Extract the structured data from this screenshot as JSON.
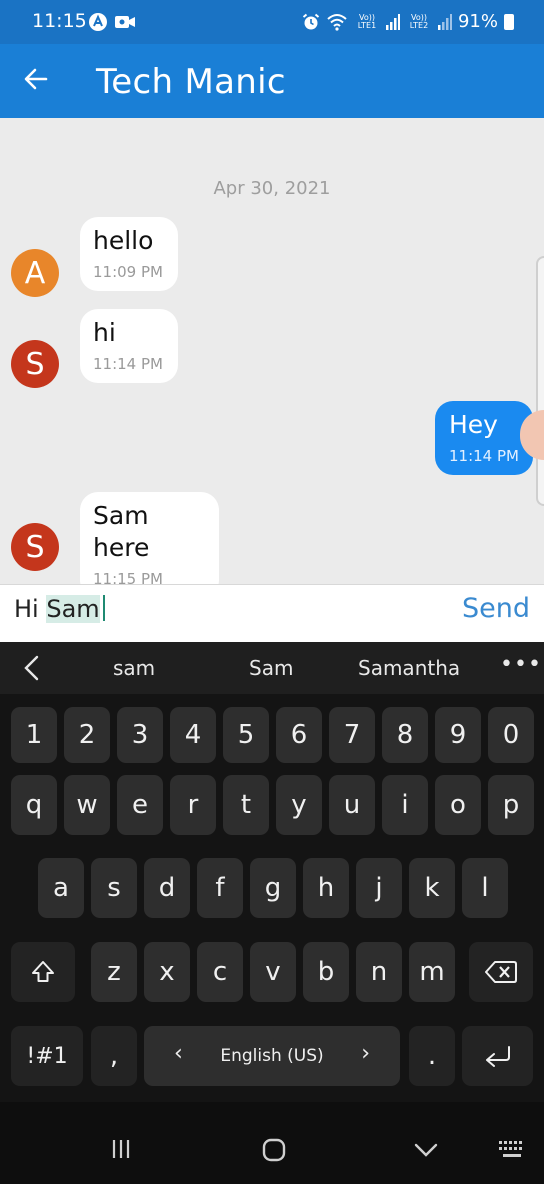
{
  "status_bar": {
    "time": "11:15",
    "battery": "91%",
    "sim1": "Vo)) LTE1",
    "sim2": "Vo)) LTE2",
    "icons": [
      "app-a-icon",
      "video-icon",
      "alarm-icon",
      "wifi-icon",
      "signal-icon",
      "battery-icon"
    ]
  },
  "app_bar": {
    "title": "Tech Manic",
    "back_icon": "back-arrow-icon"
  },
  "chat": {
    "date": "Apr 30, 2021",
    "messages": [
      {
        "avatar": "A",
        "text": "hello",
        "time": "11:09 PM",
        "direction": "in",
        "avatar_color": "#e8862a"
      },
      {
        "avatar": "S",
        "text": "hi",
        "time": "11:14 PM",
        "direction": "in",
        "avatar_color": "#c4361c"
      },
      {
        "avatar": "",
        "text": "Hey",
        "time": "11:14 PM",
        "direction": "out"
      },
      {
        "avatar": "S",
        "text": "Sam here",
        "time": "11:15 PM",
        "direction": "in",
        "avatar_color": "#c4361c"
      }
    ],
    "outgoing_color": "#1a8af0"
  },
  "composer": {
    "prefix": "Hi ",
    "highlighted_word": "Sam",
    "send_label": "Send"
  },
  "keyboard": {
    "suggestions": [
      "sam",
      "Sam",
      "Samantha"
    ],
    "more": "•••",
    "number_row": [
      "1",
      "2",
      "3",
      "4",
      "5",
      "6",
      "7",
      "8",
      "9",
      "0"
    ],
    "row1": [
      "q",
      "w",
      "e",
      "r",
      "t",
      "y",
      "u",
      "i",
      "o",
      "p"
    ],
    "row2": [
      "a",
      "s",
      "d",
      "f",
      "g",
      "h",
      "j",
      "k",
      "l"
    ],
    "row3": [
      "z",
      "x",
      "c",
      "v",
      "b",
      "n",
      "m"
    ],
    "symbols": "!#1",
    "comma": ",",
    "period": ".",
    "space_label": "English (US)",
    "space_left": "‹",
    "space_right": "›"
  },
  "nav_bar": {
    "icons": [
      "recents-icon",
      "home-icon",
      "hide-keyboard-icon",
      "keyboard-switch-icon"
    ]
  }
}
